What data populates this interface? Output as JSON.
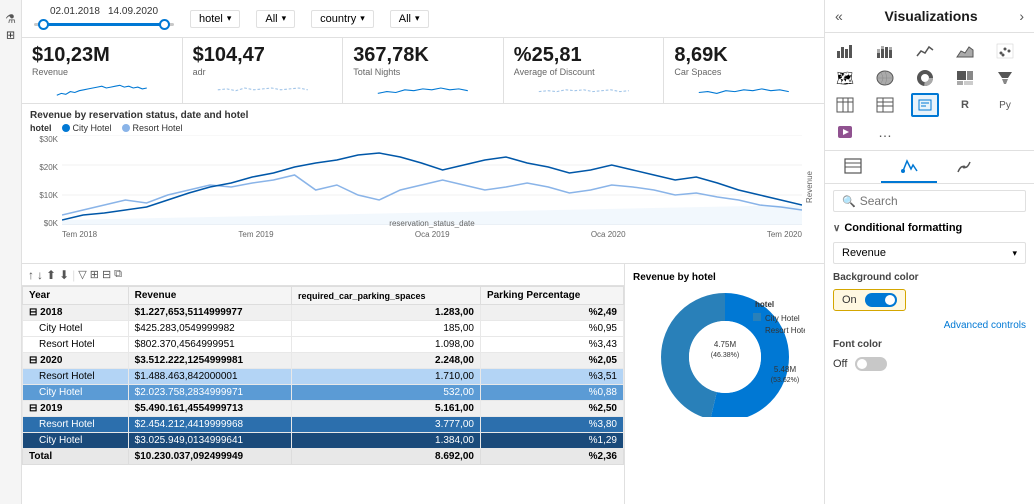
{
  "filterBar": {
    "dateStart": "02.01.2018",
    "dateEnd": "14.09.2020",
    "hotelLabel": "hotel",
    "countryLabel": "country",
    "allLabel": "All"
  },
  "kpis": [
    {
      "value": "$10,23M",
      "label": "Revenue"
    },
    {
      "value": "$104,47",
      "label": "adr"
    },
    {
      "value": "367,78K",
      "label": "Total Nights"
    },
    {
      "value": "%25,81",
      "label": "Average of Discount"
    },
    {
      "value": "8,69K",
      "label": "Car Spaces"
    }
  ],
  "lineChart": {
    "title": "Revenue by reservation status, date and hotel",
    "legendItems": [
      {
        "label": "hotel",
        "color": "#333"
      },
      {
        "label": "City Hotel",
        "color": "#0078d4"
      },
      {
        "label": "Resort Hotel",
        "color": "#8ab4e8"
      }
    ],
    "yLabels": [
      "$30K",
      "$20K",
      "$10K",
      "$0K"
    ],
    "xLabels": [
      "Tem 2018",
      "Tem 2019",
      "Oca 2019",
      "Oca 2020",
      "Tem 2020"
    ]
  },
  "tableToolbar": {
    "icons": [
      "↑",
      "↓",
      "⬆",
      "⬇",
      "▼",
      "▽",
      "⊞",
      "⊟"
    ]
  },
  "table": {
    "headers": [
      "Year",
      "Revenue",
      "required_car_parking_spaces",
      "Parking Percentage"
    ],
    "rows": [
      {
        "year": "2018",
        "revenue": "$1.227,653,5114999977",
        "parking": "1.283,00",
        "pct": "%2,49",
        "type": "group"
      },
      {
        "year": "City Hotel",
        "revenue": "$425.283,0549999982",
        "parking": "185,00",
        "pct": "%0,95",
        "type": "child"
      },
      {
        "year": "Resort Hotel",
        "revenue": "$802.370,4564999951",
        "parking": "1.098,00",
        "pct": "%3,43",
        "type": "child"
      },
      {
        "year": "2020",
        "revenue": "$3.512.222,1254999981",
        "parking": "2.248,00",
        "pct": "%2,05",
        "type": "group"
      },
      {
        "year": "Resort Hotel",
        "revenue": "$1.488.463,842000001",
        "parking": "1.710,00",
        "pct": "%3,51",
        "type": "child-highlight-medium"
      },
      {
        "year": "City Hotel",
        "revenue": "$2.023.758,2834999971",
        "parking": "532,00",
        "pct": "%0,88",
        "type": "child-highlight-dark"
      },
      {
        "year": "2019",
        "revenue": "$5.490.161,4554999713",
        "parking": "5.161,00",
        "pct": "%2,50",
        "type": "group"
      },
      {
        "year": "Resort Hotel",
        "revenue": "$2.454.212,4419999968",
        "parking": "3.777,00",
        "pct": "%3,80",
        "type": "child-highlight-blue"
      },
      {
        "year": "City Hotel",
        "revenue": "$3.025.949,0134999641",
        "parking": "1.384,00",
        "pct": "%1,29",
        "type": "child-highlight-darkblue"
      },
      {
        "year": "Total",
        "revenue": "$10.230.037,092499949",
        "parking": "8.692,00",
        "pct": "%2,36",
        "type": "total"
      }
    ]
  },
  "donutChart": {
    "title": "Revenue by hotel",
    "segments": [
      {
        "label": "City Hotel",
        "value": 46.38,
        "color": "#2980b9",
        "displayValue": "4.75M (46.38%)"
      },
      {
        "label": "Resort Hotel",
        "value": 53.62,
        "color": "#0078d4",
        "displayValue": "5.48M (53.62%)"
      }
    ]
  },
  "rightPanel": {
    "title": "Visualizations",
    "searchPlaceholder": "Search",
    "conditionalFormatting": {
      "label": "Conditional formatting",
      "dropdownValue": "Revenue",
      "bgColorLabel": "Background color",
      "toggleLabel": "On",
      "advancedControls": "Advanced controls",
      "fontColorLabel": "Font color",
      "fontToggleLabel": "Off"
    },
    "vizIcons": [
      "▦",
      "📊",
      "📈",
      "📋",
      "▤",
      "🗺",
      "⬛",
      "🔵",
      "🔲",
      "📉",
      "⊞",
      "≡",
      "🔷",
      "🔺",
      "📊",
      "🔣",
      "...",
      "",
      "",
      ""
    ],
    "tabIcons": [
      "⊞",
      "🔽",
      "🔘"
    ]
  }
}
